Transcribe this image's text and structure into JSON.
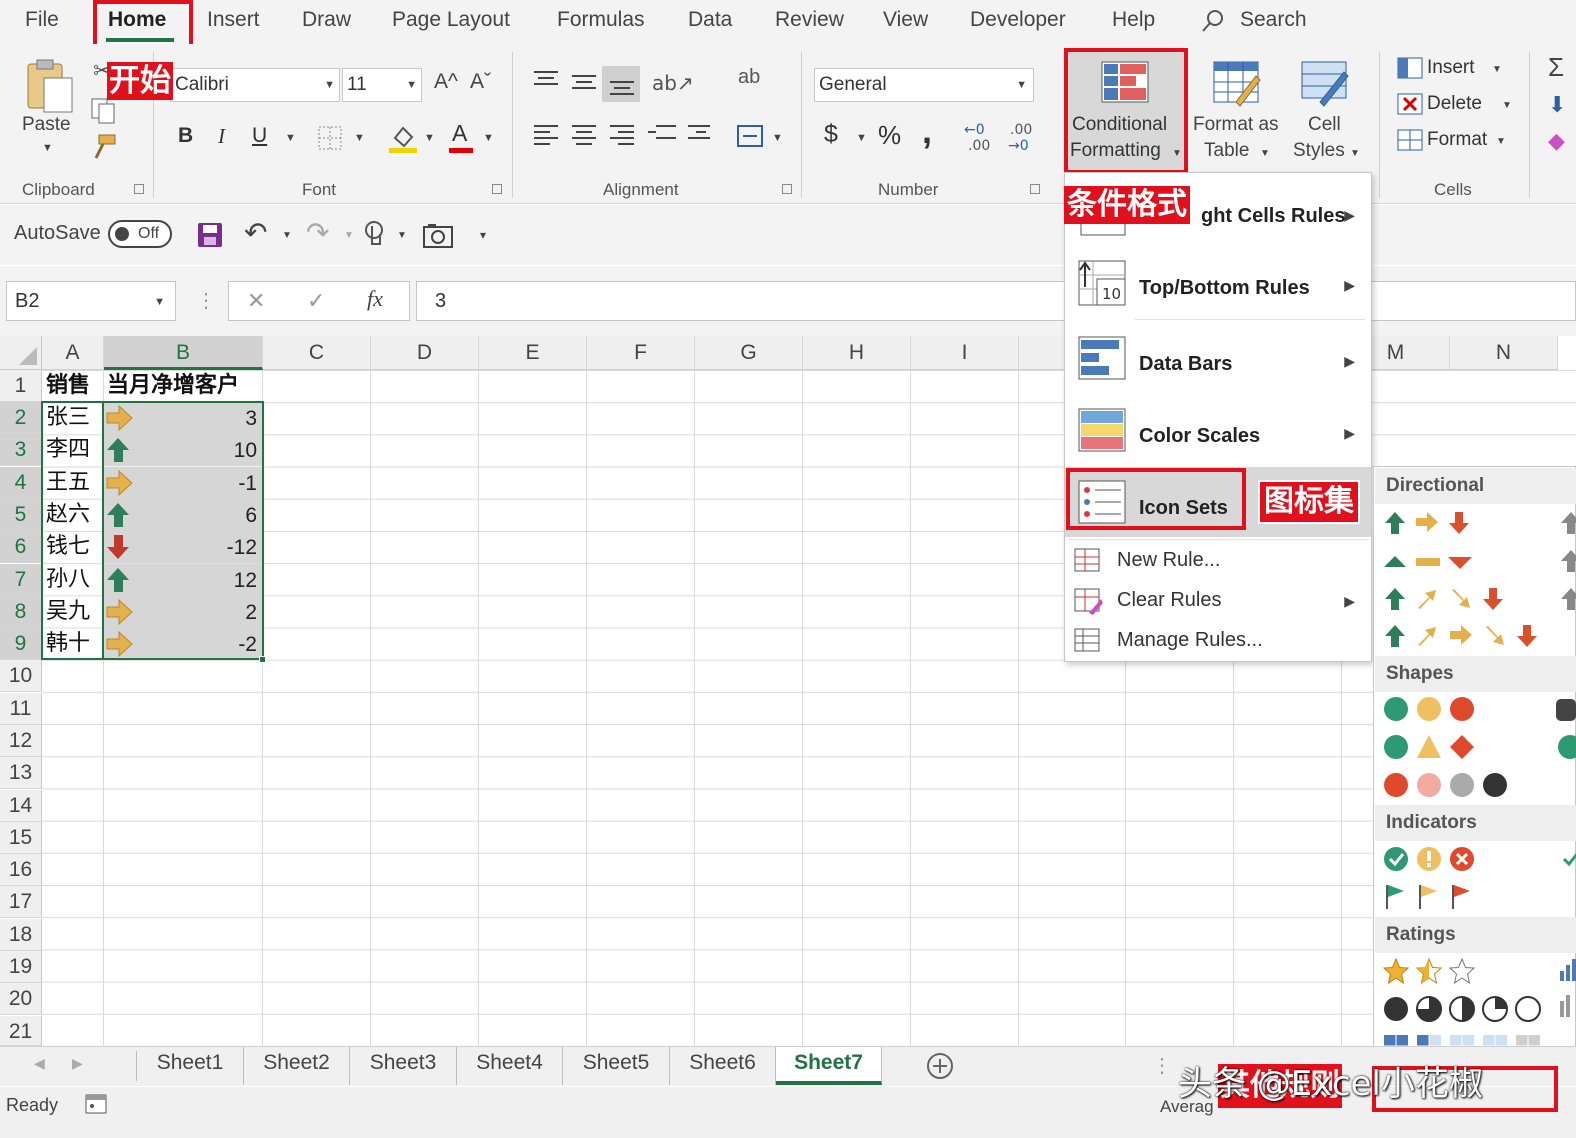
{
  "ribbon_tabs": [
    "File",
    "Home",
    "Insert",
    "Draw",
    "Page Layout",
    "Formulas",
    "Data",
    "Review",
    "View",
    "Developer",
    "Help"
  ],
  "search_label": "Search",
  "clipboard": {
    "paste_label": "Paste",
    "group_label": "Clipboard"
  },
  "font": {
    "name": "Calibri",
    "size": "11",
    "group_label": "Font",
    "bold": "B",
    "italic": "I",
    "underline": "U",
    "grow": "A^",
    "shrink": "Aˇ",
    "font_color": "A"
  },
  "alignment": {
    "group_label": "Alignment",
    "wrap": "ab"
  },
  "number": {
    "format": "General",
    "group_label": "Number",
    "currency": "$",
    "percent": "%",
    "comma": ",",
    "inc_decimal": "←0\n.00",
    "dec_decimal": ".00\n→0"
  },
  "styles": {
    "conditional_formatting_line1": "Conditional",
    "conditional_formatting_line2": "Formatting",
    "format_as_table_line1": "Format as",
    "format_as_table_line2": "Table",
    "cell_styles_line1": "Cell",
    "cell_styles_line2": "Styles"
  },
  "cells_group": {
    "insert": "Insert",
    "delete": "Delete",
    "format": "Format",
    "group_label": "Cells"
  },
  "qat": {
    "autosave_label": "AutoSave",
    "autosave_state": "Off"
  },
  "formula_bar": {
    "name_box": "B2",
    "cancel": "✕",
    "enter": "✓",
    "fx": "fx",
    "value": "3"
  },
  "columns": [
    "A",
    "B",
    "C",
    "D",
    "E",
    "F",
    "G",
    "H",
    "I",
    "M",
    "N"
  ],
  "rows": [
    "1",
    "2",
    "3",
    "4",
    "5",
    "6",
    "7",
    "8",
    "9",
    "10",
    "11",
    "12",
    "13",
    "14",
    "15",
    "16",
    "17",
    "18",
    "19",
    "20",
    "21"
  ],
  "sheet": {
    "header_a": "销售",
    "header_b": "当月净增客户",
    "data": [
      {
        "name": "张三",
        "value": "3",
        "icon": "arrow-right-icon"
      },
      {
        "name": "李四",
        "value": "10",
        "icon": "arrow-up-icon"
      },
      {
        "name": "王五",
        "value": "-1",
        "icon": "arrow-right-icon"
      },
      {
        "name": "赵六",
        "value": "6",
        "icon": "arrow-up-icon"
      },
      {
        "name": "钱七",
        "value": "-12",
        "icon": "arrow-down-icon"
      },
      {
        "name": "孙八",
        "value": "12",
        "icon": "arrow-up-icon"
      },
      {
        "name": "吴九",
        "value": "2",
        "icon": "arrow-right-icon"
      },
      {
        "name": "韩十",
        "value": "-2",
        "icon": "arrow-right-icon"
      }
    ]
  },
  "cf_menu": {
    "highlight_rules_partial": "ght Cells Rules",
    "top_bottom": "Top/Bottom Rules",
    "top_bottom_icon_number": "10",
    "data_bars": "Data Bars",
    "color_scales": "Color Scales",
    "icon_sets": "Icon Sets",
    "new_rule": "New Rule...",
    "clear_rules": "Clear Rules",
    "manage_rules": "Manage Rules..."
  },
  "icon_sets_submenu": {
    "directional": "Directional",
    "shapes": "Shapes",
    "indicators": "Indicators",
    "ratings": "Ratings"
  },
  "annotations": {
    "home_cn": "开始",
    "cf_cn": "条件格式",
    "icon_sets_cn": "图标集",
    "bottom_partial": "其他规则"
  },
  "sheet_tabs": [
    "Sheet1",
    "Sheet2",
    "Sheet3",
    "Sheet4",
    "Sheet5",
    "Sheet6",
    "Sheet7"
  ],
  "active_sheet": "Sheet7",
  "status": {
    "ready": "Ready",
    "average_partial": "Averag"
  },
  "watermark": "头条 @Excel小花椒",
  "colors": {
    "accent_green": "#217346",
    "red_annotation": "#e0101c",
    "up_arrow": "#2e7d5b",
    "right_arrow": "#e3b04b",
    "down_arrow": "#c0392b"
  }
}
